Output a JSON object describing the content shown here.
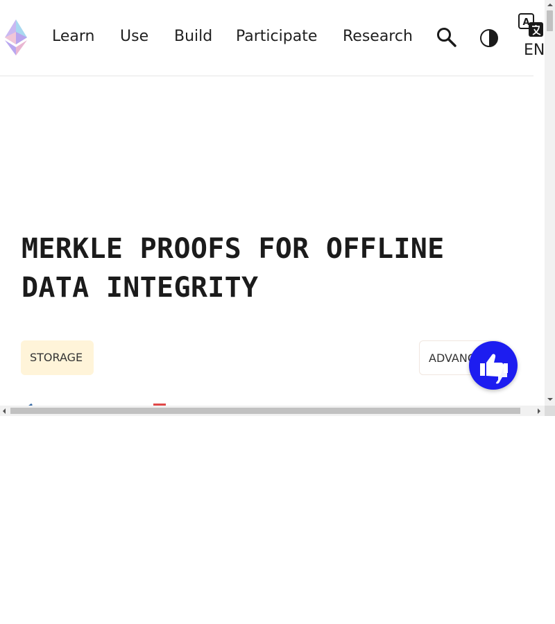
{
  "nav": {
    "logo_icon": "ethereum-logo-icon",
    "links": [
      {
        "label": "Learn"
      },
      {
        "label": "Use"
      },
      {
        "label": "Build"
      },
      {
        "label": "Participate"
      },
      {
        "label": "Research"
      }
    ],
    "search_icon": "search-icon",
    "theme_icon": "dark-mode-icon",
    "language_icon": "translate-icon",
    "language_label": "EN"
  },
  "article": {
    "title": "MERKLE PROOFS FOR OFFLINE DATA INTEGRITY",
    "tags": {
      "topic": "STORAGE",
      "level": "ADVANCED"
    }
  },
  "feedback_button": {
    "icon": "thumbs-up-down-icon",
    "color": "#1d1df0"
  },
  "colors": {
    "topic_tag_bg": "#fff4d9",
    "text": "#1b1b1b"
  }
}
